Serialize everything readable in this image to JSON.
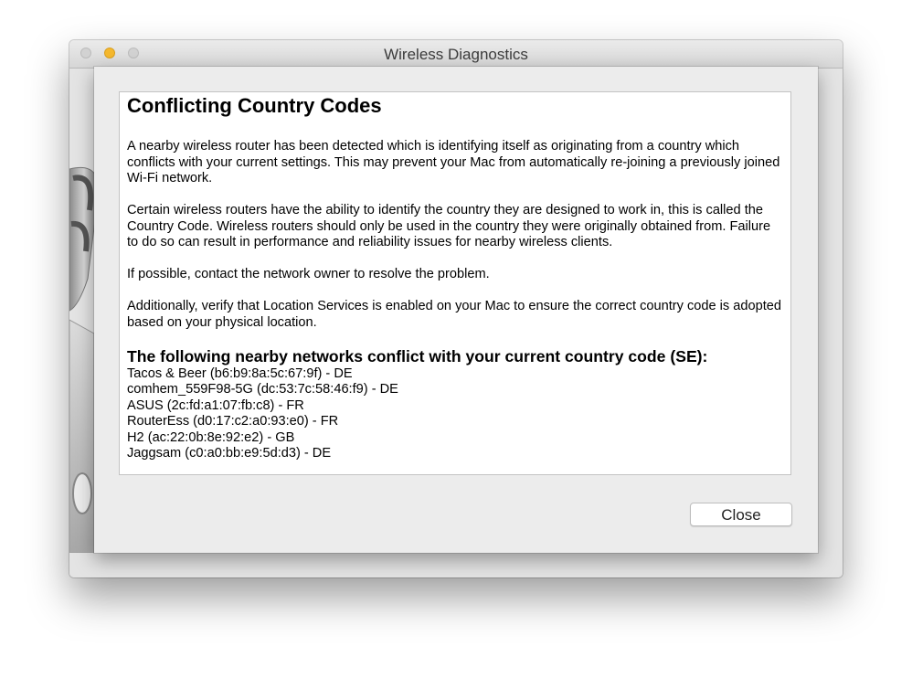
{
  "window": {
    "title": "Wireless Diagnostics",
    "traffic_lights": [
      "close",
      "minimize",
      "zoom"
    ],
    "minimize_color": "#f5b82e"
  },
  "dialog": {
    "heading": "Conflicting Country Codes",
    "paragraphs": [
      "A nearby wireless router has been detected which is identifying itself as originating from a country which conflicts with your current settings.  This may prevent your Mac from automatically re-joining a previously joined Wi-Fi network.",
      "Certain wireless routers have the ability to identify the country they are designed to work in, this is called the Country Code. Wireless routers should only be used in the country they were originally obtained from.  Failure to do so can result in performance and reliability issues for nearby wireless clients.",
      "If possible, contact the network owner to resolve the problem.",
      "Additionally, verify that Location Services is enabled on your Mac to ensure the correct country code is adopted based on your physical location."
    ],
    "list_heading": "The following nearby networks conflict with your current country code (SE):",
    "networks": [
      "Tacos & Beer (b6:b9:8a:5c:67:9f) - DE",
      "comhem_559F98-5G (dc:53:7c:58:46:f9) - DE",
      "ASUS (2c:fd:a1:07:fb:c8) - FR",
      "RouterEss (d0:17:c2:a0:93:e0) - FR",
      "H2 (ac:22:0b:8e:92:e2) - GB",
      "Jaggsam (c0:a0:bb:e9:5d:d3) - DE"
    ],
    "close_label": "Close"
  }
}
